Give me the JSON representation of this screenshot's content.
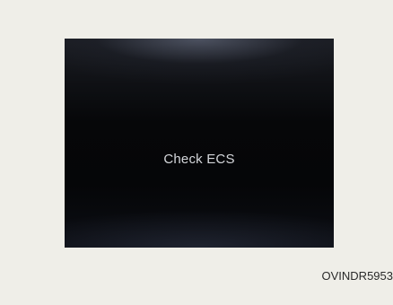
{
  "display": {
    "message": "Check ECS"
  },
  "figure": {
    "code": "OVINDR5953"
  },
  "colors": {
    "page_background": "#efeee8",
    "screen_background": "#050608",
    "message_text": "#d4d6da"
  }
}
